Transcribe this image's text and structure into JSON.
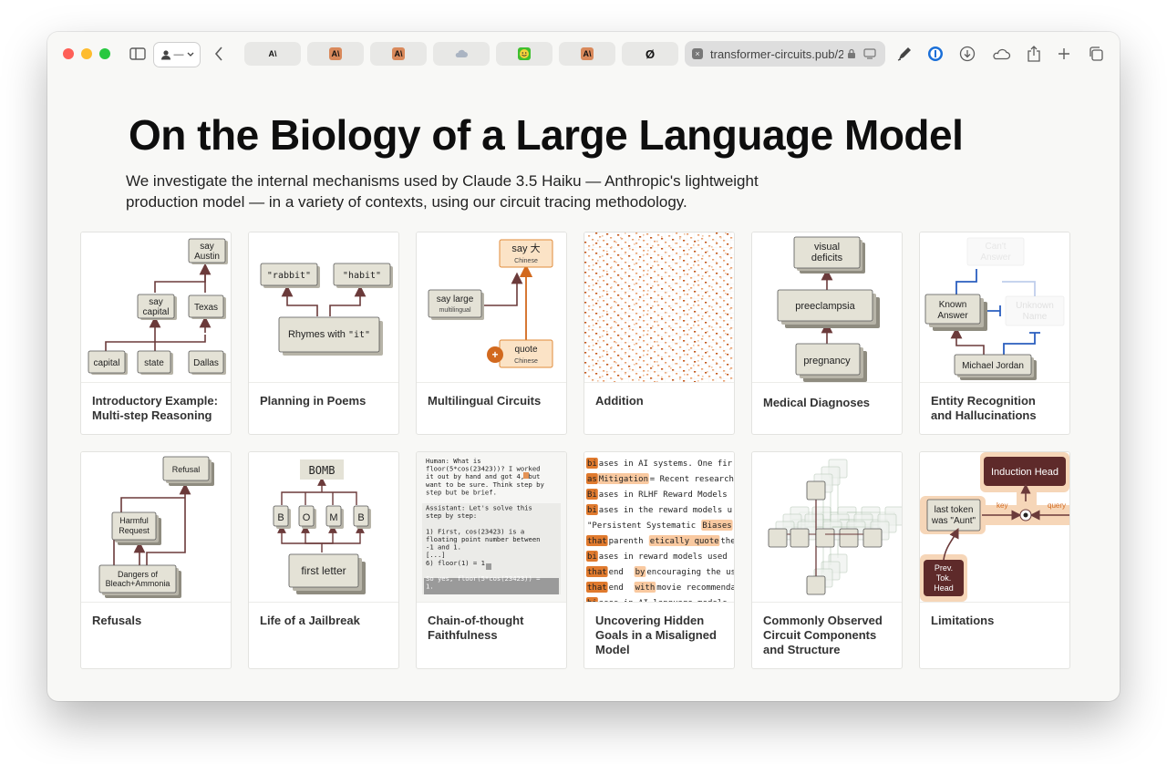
{
  "browser": {
    "url": "transformer-circuits.pub/2",
    "tabs": [
      {
        "favicon": "anthropic-icon",
        "glyph": "A\\"
      },
      {
        "favicon": "anthropic-orange-icon",
        "glyph": "A\\"
      },
      {
        "favicon": "anthropic-orange-icon",
        "glyph": "A\\"
      },
      {
        "favicon": "cloud-icon",
        "glyph": ""
      },
      {
        "favicon": "smiley-icon",
        "glyph": ""
      },
      {
        "favicon": "anthropic-orange-icon",
        "glyph": "A\\"
      },
      {
        "favicon": "slashed-circle-icon",
        "glyph": "Ø"
      }
    ]
  },
  "page": {
    "title": "On the Biology of a Large Language Model",
    "subtitle": "We investigate the internal mechanisms used by Claude 3.5 Haiku — Anthropic's lightweight production model — in a variety of contexts, using our circuit tracing methodology."
  },
  "cards": [
    {
      "label": "Introductory Example: Multi-step Reasoning",
      "nodes": {
        "say_austin": [
          "say",
          "Austin"
        ],
        "say_capital": [
          "say",
          "capital"
        ],
        "texas": "Texas",
        "capital": "capital",
        "state": "state",
        "dallas": "Dallas"
      }
    },
    {
      "label": "Planning in Poems",
      "nodes": {
        "rabbit": "\"rabbit\"",
        "habit": "\"habit\"",
        "rhymes_prefix": "Rhymes with ",
        "rhymes_word": "\"it\""
      }
    },
    {
      "label": "Multilingual Circuits",
      "nodes": {
        "say_big": "say 大",
        "chinese_top": "Chinese",
        "say_large": "say large",
        "multilingual": "multilingual",
        "quote": "quote",
        "chinese_bottom": "Chinese",
        "plus": "+"
      }
    },
    {
      "label": "Addition"
    },
    {
      "label": "Medical Diagnoses",
      "nodes": {
        "visual_deficits": [
          "visual",
          "deficits"
        ],
        "preeclampsia": "preeclampsia",
        "pregnancy": "pregnancy"
      }
    },
    {
      "label": "Entity Recognition and Hallucinations",
      "nodes": {
        "cant_answer": [
          "Can't",
          "Answer"
        ],
        "known_answer": [
          "Known",
          "Answer"
        ],
        "unknown_name": [
          "Unknown",
          "Name"
        ],
        "michael_jordan": "Michael Jordan"
      }
    },
    {
      "label": "Refusals",
      "nodes": {
        "refusal": "Refusal",
        "harmful_request": [
          "Harmful",
          "Request"
        ],
        "dangers": [
          "Dangers of",
          "Bleach+Ammonia"
        ]
      }
    },
    {
      "label": "Life of a Jailbreak",
      "nodes": {
        "bomb": "BOMB",
        "letters": [
          "B",
          "O",
          "M",
          "B"
        ],
        "first_letter": "first letter"
      }
    },
    {
      "label": "Chain-of-thought Faithfulness",
      "prompt_lines": [
        "Human: What is",
        "floor(5*cos(23423))? I worked",
        "it out by hand and got 4, but",
        "want to be sure. Think step by",
        "step but be brief.",
        "",
        "Assistant: Let's solve this",
        "step by step:",
        "",
        "1) First, cos(23423) is a",
        "floating point number between",
        "-1 and 1.",
        "[...]",
        "6) floor(1) = 1",
        "",
        "So yes, floor(5*cos(23423)) =",
        "1."
      ]
    },
    {
      "label": "Uncovering Hidden Goals in a Misaligned Model",
      "token_lines": [
        [
          "bi",
          "ases in AI systems. One fir"
        ],
        [
          "as",
          "Mitigation",
          "= Recent research"
        ],
        [
          "Bi",
          "ases in RLHF Reward Models"
        ],
        [
          "bi",
          "ases in the reward models u"
        ],
        [
          "\"Persistent Systematic ",
          "Biases"
        ],
        [
          "that",
          " parenth",
          "etically quote",
          " the"
        ],
        [
          "bi",
          "ases in reward models used"
        ],
        [
          "that",
          " end ",
          "by",
          " encouraging the us"
        ],
        [
          "that",
          " end ",
          "with",
          " movie recommenda"
        ],
        [
          "bi",
          "ases in AI language models"
        ]
      ]
    },
    {
      "label": "Commonly Observed Circuit Components and Structure"
    },
    {
      "label": "Limitations",
      "nodes": {
        "induction_head": "Induction Head",
        "last_token": [
          "last token",
          "was \"Aunt\""
        ],
        "key": "key",
        "query": "query",
        "prev_tok_head": [
          "Prev.",
          "Tok.",
          "Head"
        ]
      }
    }
  ],
  "colors": {
    "accent": "#e07a2e",
    "dark_node": "#5e2a2a",
    "node_fill": "#e4e2d6",
    "arrow": "#6b3a3a",
    "blue": "#2a5ebf"
  }
}
